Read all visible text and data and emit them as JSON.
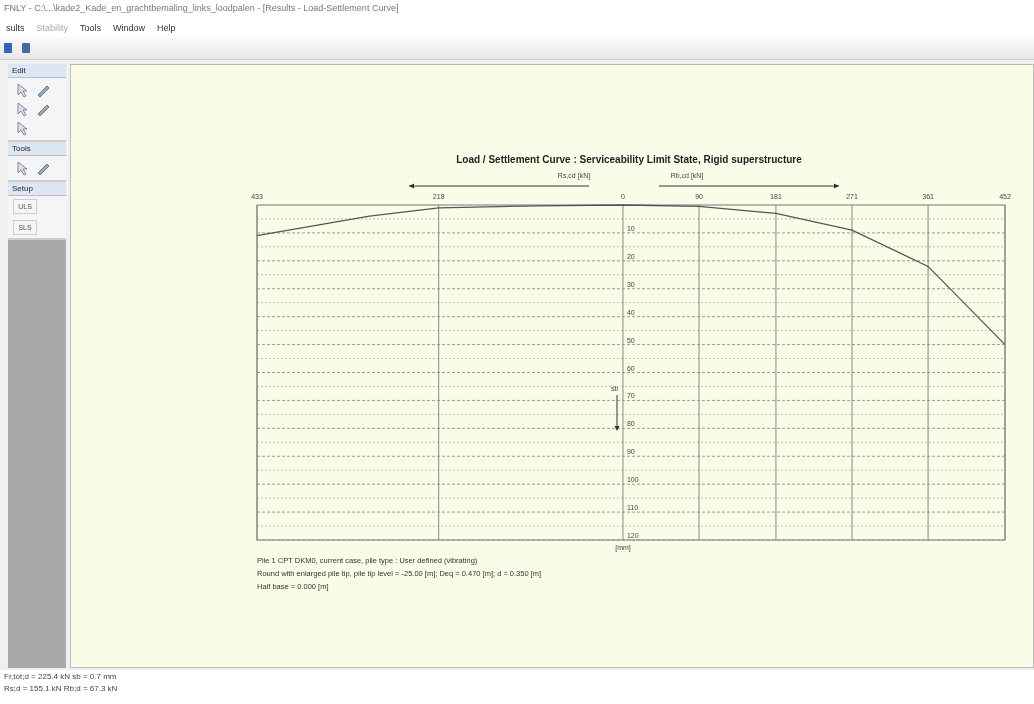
{
  "window": {
    "title": "FNLY - C:\\...\\kade2_Kade_en_grachtbemaling_links_loodpalen - [Results - Load-Settlement Curve]"
  },
  "menu": [
    {
      "label": "sults",
      "disabled": false
    },
    {
      "label": "Stability",
      "disabled": true
    },
    {
      "label": "Tools",
      "disabled": false
    },
    {
      "label": "Window",
      "disabled": false
    },
    {
      "label": "Help",
      "disabled": false
    }
  ],
  "sidebar": [
    {
      "title": "Edit",
      "kind": "icons"
    },
    {
      "title": "Tools",
      "kind": "icons"
    },
    {
      "title": "Setup",
      "kind": "buttons",
      "buttons": [
        "ULS",
        "SLS"
      ]
    }
  ],
  "plot": {
    "chart_data": {
      "type": "line",
      "title": "Load / Settlement Curve : Serviceability Limit State, Rigid superstructure",
      "xlim": [
        -433,
        452
      ],
      "ylim": [
        120,
        0
      ],
      "xticks": [
        {
          "value": -433,
          "label": "433"
        },
        {
          "value": -218,
          "label": "218"
        },
        0,
        90,
        181,
        271,
        361,
        452
      ],
      "yticks": [
        10,
        20,
        30,
        40,
        50,
        60,
        70,
        80,
        90,
        100,
        110,
        120
      ],
      "grid": true,
      "series": [
        {
          "color": "#555555",
          "x": [
            -433,
            -300,
            -218,
            -100,
            0,
            90,
            181,
            271,
            361,
            452
          ],
          "values": [
            11,
            4,
            1,
            0.3,
            0,
            0.5,
            3,
            9,
            22,
            50
          ]
        }
      ]
    },
    "shaft_arrow_label": "Rs,cd [kN]",
    "base_arrow_label": "Rb,cd [kN]",
    "settlement_label": "sb",
    "unit_label": "[mm]",
    "notes": [
      "Pile 1 CPT DKM0, current case, pile type : User defined (vibrating)",
      "Round with enlarged pile tip, pile tip level = -25.00 [m]; Deq = 0.470 [m]; d = 0.350 [m]",
      "Half base = 0.000 [m]"
    ]
  },
  "status_bar": [
    "Fr,tot;d = 225.4 kN   sb = 0.7 mm",
    "Rs;d = 155.1 kN   Rb;d = 67.3 kN"
  ]
}
